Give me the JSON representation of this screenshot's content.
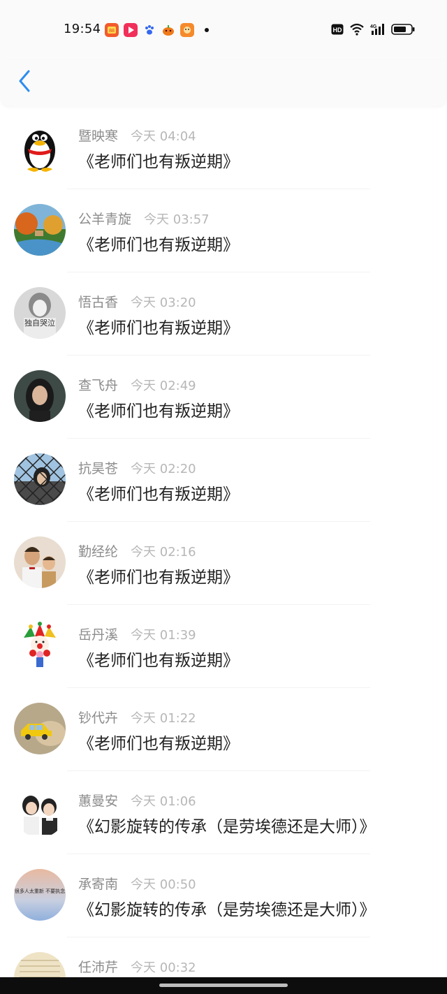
{
  "status_bar": {
    "time": "19:54",
    "notification_icons": [
      "shopping-app-icon",
      "video-app-icon",
      "paw-app-icon",
      "pumpkin-app-icon",
      "game-app-icon"
    ],
    "system_icons": [
      "hd-icon",
      "wifi-icon",
      "signal-4g-icon",
      "battery-icon"
    ],
    "hd_label": "HD",
    "network_label": "4G"
  },
  "header": {
    "back_icon": "chevron-left-icon",
    "accent": "#2d8cf0"
  },
  "list": [
    {
      "name": "暨映寒",
      "time": "今天 04:04",
      "title": "《老师们也有叛逆期》",
      "avatar": "penguin"
    },
    {
      "name": "公羊青旋",
      "time": "今天 03:57",
      "title": "《老师们也有叛逆期》",
      "avatar": "landscape"
    },
    {
      "name": "悟古香",
      "time": "今天 03:20",
      "title": "《老师们也有叛逆期》",
      "avatar": "gray-girl"
    },
    {
      "name": "查飞舟",
      "time": "今天 02:49",
      "title": "《老师们也有叛逆期》",
      "avatar": "dark-portrait"
    },
    {
      "name": "抗昊苍",
      "time": "今天 02:20",
      "title": "《老师们也有叛逆期》",
      "avatar": "fence"
    },
    {
      "name": "勤经纶",
      "time": "今天 02:16",
      "title": "《老师们也有叛逆期》",
      "avatar": "family"
    },
    {
      "name": "岳丹溪",
      "time": "今天 01:39",
      "title": "《老师们也有叛逆期》",
      "avatar": "clown"
    },
    {
      "name": "钞代卉",
      "time": "今天 01:22",
      "title": "《老师们也有叛逆期》",
      "avatar": "yellow-car"
    },
    {
      "name": "蕙曼安",
      "time": "今天 01:06",
      "title": "《幻影旋转的传承（是劳埃德还是大师）》",
      "avatar": "children"
    },
    {
      "name": "承寄南",
      "time": "今天 00:50",
      "title": "《幻影旋转的传承（是劳埃德还是大师）》",
      "avatar": "text-sky"
    },
    {
      "name": "任沛芹",
      "time": "今天 00:32",
      "title": "",
      "avatar": "paper"
    }
  ],
  "avatar_text": {
    "gray-girl": "独自哭泣",
    "text-sky": "很多人太重新 不要执念"
  },
  "colors": {
    "name": "#8c8c8c",
    "time": "#b7b7b7",
    "title": "#222222",
    "divider": "#f2f2f2"
  }
}
